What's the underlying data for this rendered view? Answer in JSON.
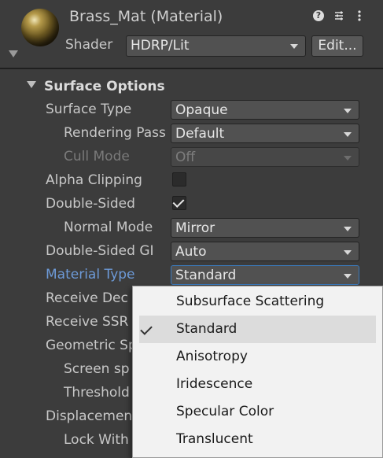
{
  "header": {
    "title": "Brass_Mat (Material)",
    "shader_label": "Shader",
    "shader_value": "HDRP/Lit",
    "edit_label": "Edit...",
    "icons": [
      "help-icon",
      "preset-icon",
      "more-icon"
    ]
  },
  "section": {
    "title": "Surface Options"
  },
  "rows": {
    "surface_type": {
      "label": "Surface Type",
      "value": "Opaque"
    },
    "rendering_pass": {
      "label": "Rendering Pass",
      "value": "Default"
    },
    "cull_mode": {
      "label": "Cull Mode",
      "value": "Off"
    },
    "alpha_clipping": {
      "label": "Alpha Clipping",
      "checked": false
    },
    "double_sided": {
      "label": "Double-Sided",
      "checked": true
    },
    "normal_mode": {
      "label": "Normal Mode",
      "value": "Mirror"
    },
    "double_sided_gi": {
      "label": "Double-Sided GI",
      "value": "Auto"
    },
    "material_type": {
      "label": "Material Type",
      "value": "Standard"
    },
    "receive_decals": {
      "label": "Receive Dec"
    },
    "receive_ssr": {
      "label": "Receive SSR"
    },
    "geometric_specular": {
      "label": "Geometric Sp"
    },
    "screen_space": {
      "label": "Screen sp"
    },
    "threshold": {
      "label": "Threshold"
    },
    "displacement": {
      "label": "Displacement"
    },
    "lock_with": {
      "label": "Lock With"
    }
  },
  "material_type_menu": {
    "selected": "Standard",
    "options": [
      "Subsurface Scattering",
      "Standard",
      "Anisotropy",
      "Iridescence",
      "Specular Color",
      "Translucent"
    ]
  }
}
